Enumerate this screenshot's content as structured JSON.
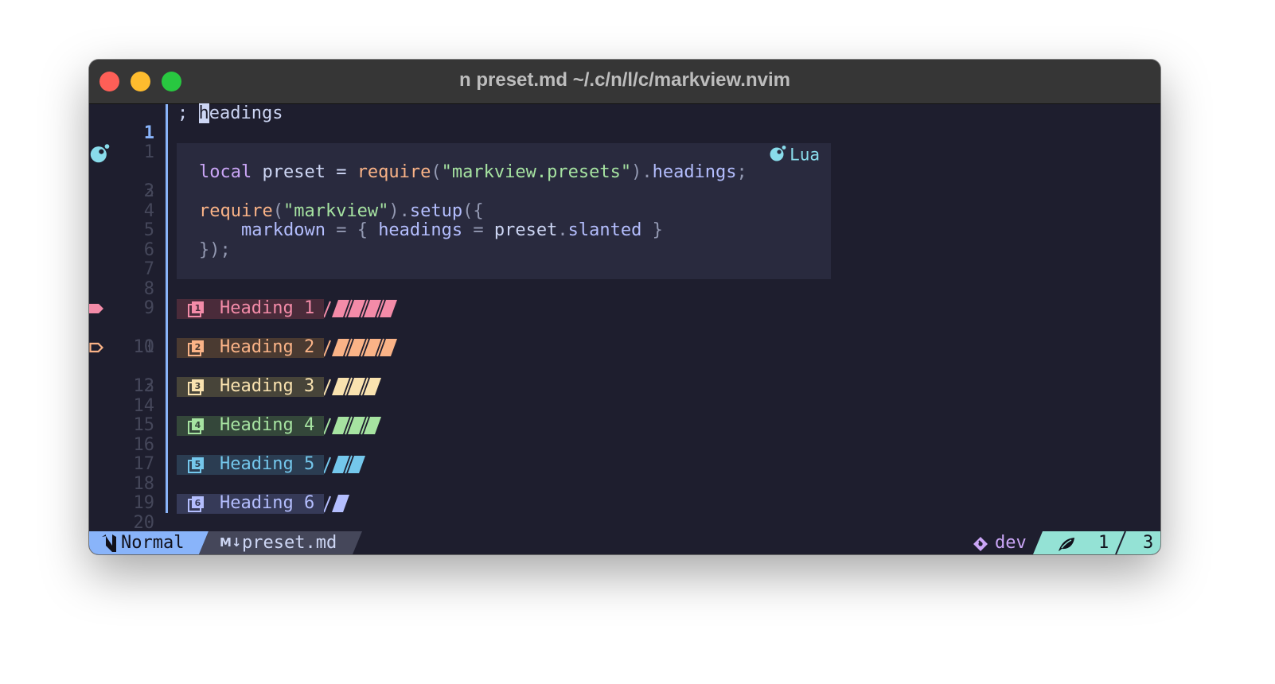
{
  "window": {
    "title": "n preset.md ~/.c/n/l/c/markview.nvim"
  },
  "line_numbers": [
    "1",
    "1",
    "2",
    "3",
    "4",
    "5",
    "6",
    "7",
    "8",
    "9",
    "10",
    "11",
    "12",
    "13",
    "14",
    "15",
    "16",
    "17",
    "18",
    "19",
    "20"
  ],
  "buffer": {
    "line1_prefix": "; ",
    "line1_cursor_char": "h",
    "line1_rest": "eadings"
  },
  "code_block": {
    "language": "Lua",
    "language_icon": "lua-icon",
    "line3": {
      "kw": "local",
      "var": " preset = ",
      "fn": "require",
      "open": "(",
      "str": "\"markview.presets\"",
      "close": ").",
      "prop": "headings",
      "end": ";"
    },
    "line5": {
      "fn": "require",
      "open": "(",
      "str": "\"markview\"",
      "close": ").",
      "prop": "setup",
      "end": "({"
    },
    "line6": {
      "indent": "    ",
      "key": "markdown",
      "mid": " = { ",
      "key2": "headings",
      "eq": " = ",
      "obj": "preset",
      "dot": ".",
      "prop": "slanted",
      "end": " }"
    },
    "line7": "});"
  },
  "headings": [
    {
      "label": "Heading 1",
      "icon": "heading-1-icon",
      "color": "#f38ba8",
      "bg": "#4a2b3a",
      "slants": 4
    },
    {
      "label": "Heading 2",
      "icon": "heading-2-icon",
      "color": "#fab387",
      "bg": "#4a3a31",
      "slants": 4
    },
    {
      "label": "Heading 3",
      "icon": "heading-3-icon",
      "color": "#f9e2af",
      "bg": "#474439",
      "slants": 3
    },
    {
      "label": "Heading 4",
      "icon": "heading-4-icon",
      "color": "#a6e3a1",
      "bg": "#34473a",
      "slants": 3
    },
    {
      "label": "Heading 5",
      "icon": "heading-5-icon",
      "color": "#74c7ec",
      "bg": "#2b3d52",
      "slants": 2
    },
    {
      "label": "Heading 6",
      "icon": "heading-6-icon",
      "color": "#b4befe",
      "bg": "#363a58",
      "slants": 1
    }
  ],
  "statusline": {
    "mode_icon": "neovim-icon",
    "mode": "Normal",
    "file_icon": "M↓",
    "file": "preset.md",
    "branch_icon": "git-icon",
    "branch": "dev",
    "position_icon": "leaf-icon",
    "position_current": "1",
    "position_sep": "/",
    "position_total": "3"
  },
  "colors": {
    "background": "#1e1e2e",
    "accent": "#89b4fa",
    "mode_bg": "#89b4fa",
    "position_bg": "#94e2d5"
  }
}
